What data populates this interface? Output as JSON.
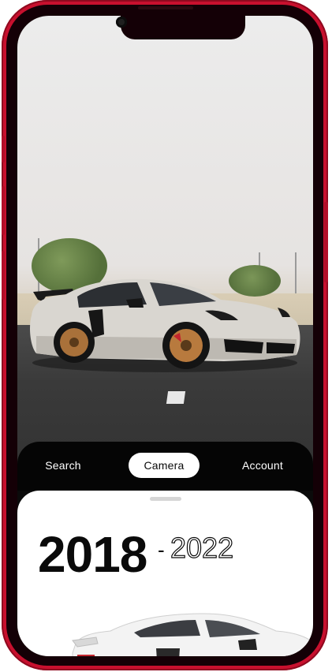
{
  "device": {
    "frame_color": "#c8102e"
  },
  "photo": {
    "subject_icon": "sports-car-photo"
  },
  "tabbar": {
    "tabs": [
      {
        "label": "Search",
        "active": false
      },
      {
        "label": "Camera",
        "active": true
      },
      {
        "label": "Account",
        "active": false
      }
    ]
  },
  "card": {
    "year_start": "2018",
    "year_separator": "-",
    "year_end": "2022",
    "preview_icon": "sports-car-illustration"
  }
}
